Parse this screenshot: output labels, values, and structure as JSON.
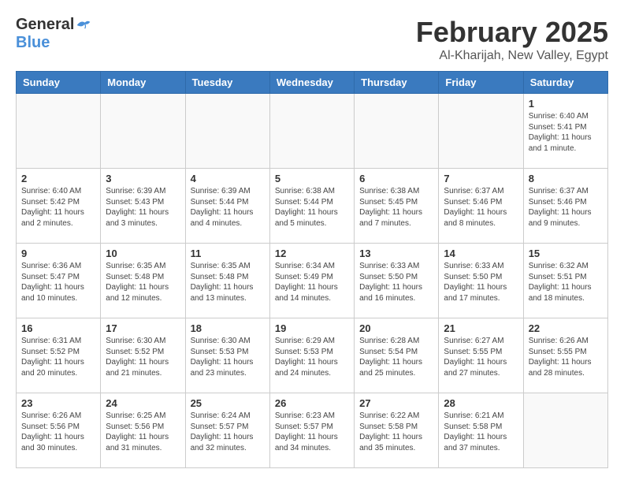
{
  "header": {
    "logo_general": "General",
    "logo_blue": "Blue",
    "month_title": "February 2025",
    "location": "Al-Kharijah, New Valley, Egypt"
  },
  "weekdays": [
    "Sunday",
    "Monday",
    "Tuesday",
    "Wednesday",
    "Thursday",
    "Friday",
    "Saturday"
  ],
  "weeks": [
    [
      {
        "day": "",
        "info": ""
      },
      {
        "day": "",
        "info": ""
      },
      {
        "day": "",
        "info": ""
      },
      {
        "day": "",
        "info": ""
      },
      {
        "day": "",
        "info": ""
      },
      {
        "day": "",
        "info": ""
      },
      {
        "day": "1",
        "info": "Sunrise: 6:40 AM\nSunset: 5:41 PM\nDaylight: 11 hours\nand 1 minute."
      }
    ],
    [
      {
        "day": "2",
        "info": "Sunrise: 6:40 AM\nSunset: 5:42 PM\nDaylight: 11 hours\nand 2 minutes."
      },
      {
        "day": "3",
        "info": "Sunrise: 6:39 AM\nSunset: 5:43 PM\nDaylight: 11 hours\nand 3 minutes."
      },
      {
        "day": "4",
        "info": "Sunrise: 6:39 AM\nSunset: 5:44 PM\nDaylight: 11 hours\nand 4 minutes."
      },
      {
        "day": "5",
        "info": "Sunrise: 6:38 AM\nSunset: 5:44 PM\nDaylight: 11 hours\nand 5 minutes."
      },
      {
        "day": "6",
        "info": "Sunrise: 6:38 AM\nSunset: 5:45 PM\nDaylight: 11 hours\nand 7 minutes."
      },
      {
        "day": "7",
        "info": "Sunrise: 6:37 AM\nSunset: 5:46 PM\nDaylight: 11 hours\nand 8 minutes."
      },
      {
        "day": "8",
        "info": "Sunrise: 6:37 AM\nSunset: 5:46 PM\nDaylight: 11 hours\nand 9 minutes."
      }
    ],
    [
      {
        "day": "9",
        "info": "Sunrise: 6:36 AM\nSunset: 5:47 PM\nDaylight: 11 hours\nand 10 minutes."
      },
      {
        "day": "10",
        "info": "Sunrise: 6:35 AM\nSunset: 5:48 PM\nDaylight: 11 hours\nand 12 minutes."
      },
      {
        "day": "11",
        "info": "Sunrise: 6:35 AM\nSunset: 5:48 PM\nDaylight: 11 hours\nand 13 minutes."
      },
      {
        "day": "12",
        "info": "Sunrise: 6:34 AM\nSunset: 5:49 PM\nDaylight: 11 hours\nand 14 minutes."
      },
      {
        "day": "13",
        "info": "Sunrise: 6:33 AM\nSunset: 5:50 PM\nDaylight: 11 hours\nand 16 minutes."
      },
      {
        "day": "14",
        "info": "Sunrise: 6:33 AM\nSunset: 5:50 PM\nDaylight: 11 hours\nand 17 minutes."
      },
      {
        "day": "15",
        "info": "Sunrise: 6:32 AM\nSunset: 5:51 PM\nDaylight: 11 hours\nand 18 minutes."
      }
    ],
    [
      {
        "day": "16",
        "info": "Sunrise: 6:31 AM\nSunset: 5:52 PM\nDaylight: 11 hours\nand 20 minutes."
      },
      {
        "day": "17",
        "info": "Sunrise: 6:30 AM\nSunset: 5:52 PM\nDaylight: 11 hours\nand 21 minutes."
      },
      {
        "day": "18",
        "info": "Sunrise: 6:30 AM\nSunset: 5:53 PM\nDaylight: 11 hours\nand 23 minutes."
      },
      {
        "day": "19",
        "info": "Sunrise: 6:29 AM\nSunset: 5:53 PM\nDaylight: 11 hours\nand 24 minutes."
      },
      {
        "day": "20",
        "info": "Sunrise: 6:28 AM\nSunset: 5:54 PM\nDaylight: 11 hours\nand 25 minutes."
      },
      {
        "day": "21",
        "info": "Sunrise: 6:27 AM\nSunset: 5:55 PM\nDaylight: 11 hours\nand 27 minutes."
      },
      {
        "day": "22",
        "info": "Sunrise: 6:26 AM\nSunset: 5:55 PM\nDaylight: 11 hours\nand 28 minutes."
      }
    ],
    [
      {
        "day": "23",
        "info": "Sunrise: 6:26 AM\nSunset: 5:56 PM\nDaylight: 11 hours\nand 30 minutes."
      },
      {
        "day": "24",
        "info": "Sunrise: 6:25 AM\nSunset: 5:56 PM\nDaylight: 11 hours\nand 31 minutes."
      },
      {
        "day": "25",
        "info": "Sunrise: 6:24 AM\nSunset: 5:57 PM\nDaylight: 11 hours\nand 32 minutes."
      },
      {
        "day": "26",
        "info": "Sunrise: 6:23 AM\nSunset: 5:57 PM\nDaylight: 11 hours\nand 34 minutes."
      },
      {
        "day": "27",
        "info": "Sunrise: 6:22 AM\nSunset: 5:58 PM\nDaylight: 11 hours\nand 35 minutes."
      },
      {
        "day": "28",
        "info": "Sunrise: 6:21 AM\nSunset: 5:58 PM\nDaylight: 11 hours\nand 37 minutes."
      },
      {
        "day": "",
        "info": ""
      }
    ]
  ]
}
